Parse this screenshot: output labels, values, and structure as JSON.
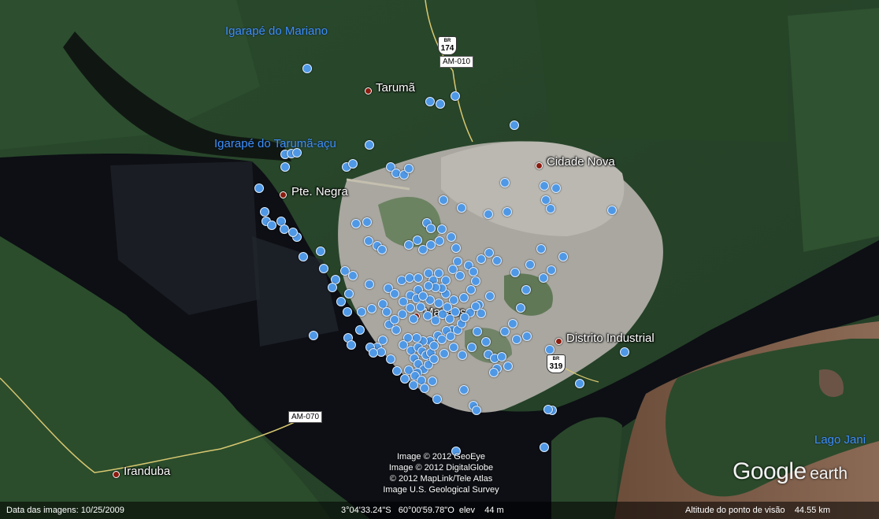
{
  "map": {
    "places": [
      {
        "id": "taruma",
        "name": "Tarumã"
      },
      {
        "id": "cidade-nova",
        "name": "Cidade Nova"
      },
      {
        "id": "pte-negra",
        "name": "Pte. Negra"
      },
      {
        "id": "manaus",
        "name": "Manaus"
      },
      {
        "id": "distrito-industrial",
        "name": "Distrito Industrial"
      },
      {
        "id": "iranduba",
        "name": "Iranduba"
      }
    ],
    "water_labels": [
      {
        "id": "igarape-do-mariano",
        "name": "Igarapé do Mariano"
      },
      {
        "id": "igarape-do-taruma-acu",
        "name": "Igarapé do Tarumã-açu"
      },
      {
        "id": "lago-janauari",
        "name": "Lago Jani"
      }
    ],
    "road_shields": [
      {
        "id": "br-174",
        "prefix": "BR",
        "number": "174"
      },
      {
        "id": "br-319",
        "prefix": "BR",
        "number": "319"
      }
    ],
    "road_tags": [
      {
        "id": "am-010",
        "label": "AM-010"
      },
      {
        "id": "am-070",
        "label": "AM-070"
      }
    ],
    "marker_count": 197,
    "colors": {
      "marker": "#4f98e6",
      "place_dot": "#8b1b10",
      "water_label": "#3d8ff5",
      "river_dark": "#0d0f14",
      "river_muddy": "#7a5a44"
    }
  },
  "credits": [
    "Image © 2012 GeoEye",
    "Image © 2012 DigitalGlobe",
    "© 2012 MapLink/Tele Atlas",
    "Image U.S. Geological Survey"
  ],
  "logo": {
    "brand": "Google",
    "product": "earth"
  },
  "status": {
    "imagery_date": "Data das imagens: 10/25/2009",
    "coordinates": "3°04'33.24\"S   60°00'59.78\"O  elev    44 m",
    "eye_altitude": "Altitude do ponto de visão    44.55 km"
  }
}
